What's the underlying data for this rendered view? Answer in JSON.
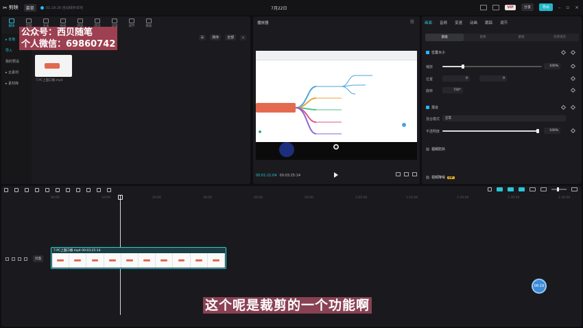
{
  "app": {
    "name": "剪映",
    "menu_label": "菜单",
    "autosave_text": "01:18:26 自动保存本地",
    "project_title": "7月22日"
  },
  "topbar": {
    "vip_label": "VIP",
    "share_label": "分享",
    "export_label": "导出"
  },
  "media": {
    "tabs": [
      {
        "label": "媒体"
      },
      {
        "label": "音频"
      },
      {
        "label": "文本"
      },
      {
        "label": "贴纸"
      },
      {
        "label": "特效"
      },
      {
        "label": "转场"
      },
      {
        "label": "滤镜"
      },
      {
        "label": "调节"
      },
      {
        "label": "模板"
      }
    ],
    "side_nav": [
      {
        "label": "▸ 本地"
      },
      {
        "label": "导入"
      },
      {
        "label": "我的预设"
      },
      {
        "label": "▸ 云素材"
      },
      {
        "label": "▸ 素材库"
      }
    ],
    "sort_label": "排序",
    "filter_label": "全部",
    "clip_name": "7.PC上面口播.mp4"
  },
  "watermark": {
    "line1": "公众号：西贝随笔",
    "line2": "个人微信：69860742"
  },
  "player": {
    "title": "播放器",
    "current_time": "00:01:21:04",
    "total_time": "00:03:25:14"
  },
  "attributes": {
    "tabs": [
      {
        "label": "画面"
      },
      {
        "label": "音频"
      },
      {
        "label": "变速"
      },
      {
        "label": "动画"
      },
      {
        "label": "跟踪"
      },
      {
        "label": "调节"
      }
    ],
    "sub_tabs": [
      {
        "label": "基础"
      },
      {
        "label": "抠像"
      },
      {
        "label": "蒙版"
      },
      {
        "label": "背景填充"
      }
    ],
    "position_size_title": "位置大小",
    "scale_label": "缩放",
    "scale_value": "100%",
    "position_label": "位置",
    "pos_x": "0",
    "pos_y": "0",
    "rotate_label": "旋转",
    "rotate_value": "720°",
    "blend_title": "混合",
    "blend_mode_label": "混合模式",
    "blend_mode_value": "正常",
    "opacity_label": "不透明度",
    "opacity_value": "100%",
    "stabilize_title": "视频防抖",
    "denoise_title": "视频降噪",
    "denoise_badge": "VIP"
  },
  "timeline": {
    "ruler_ticks": [
      "00:00",
      "10:00",
      "20:00",
      "30:00",
      "40:00",
      "50:00",
      "1:00:00",
      "1:10:00",
      "1:20:00",
      "1:30:00",
      "1:40:00",
      "1:50:00"
    ],
    "cover_label": "封面",
    "clip_label": "7.PC上面口播.mp4  00:03:25:14"
  },
  "float_badge": "06:19",
  "subtitle": "这个呢是裁剪的一个功能啊",
  "colors": {
    "accent": "#2bc4d8",
    "export": "#21b8c9",
    "watermark_bg": "#b4465a",
    "clip_border": "#37c6d2"
  }
}
